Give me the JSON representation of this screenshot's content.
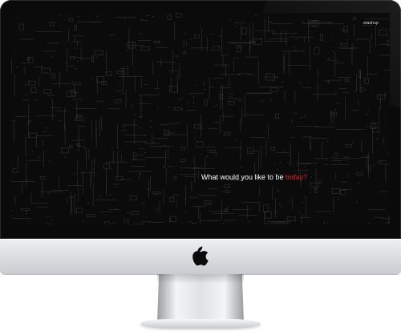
{
  "screen": {
    "logo_text": "stashup",
    "tagline_prefix": "What would you like to be ",
    "tagline_highlight": "today?",
    "highlight_color": "#d21f1f",
    "background_pattern": "circuit-schematic"
  },
  "device": {
    "brand_icon": "apple-icon"
  }
}
